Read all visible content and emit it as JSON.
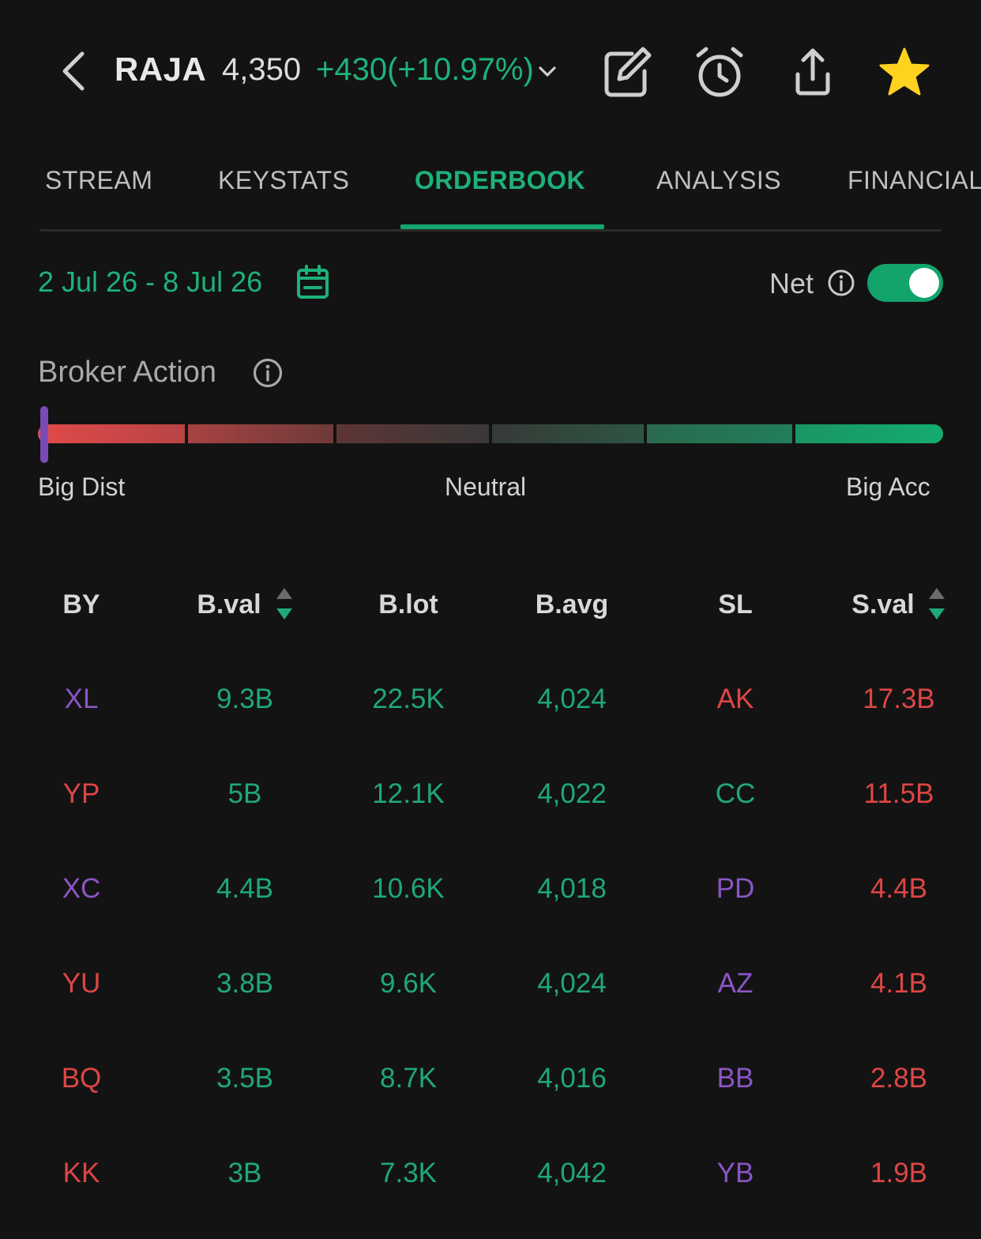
{
  "header": {
    "ticker": "RAJA",
    "price": "4,350",
    "change": "+430(+10.97%)"
  },
  "icons": {
    "back": "chevron-left-icon",
    "change_caret": "chevron-down-icon",
    "edit": "edit-icon",
    "alarm": "alarm-clock-icon",
    "share": "share-icon",
    "favorite": "star-icon",
    "calendar": "calendar-icon",
    "info": "info-icon",
    "sort": "sort-icon"
  },
  "tabs": [
    {
      "label": "STREAM"
    },
    {
      "label": "KEYSTATS"
    },
    {
      "label": "ORDERBOOK"
    },
    {
      "label": "ANALYSIS"
    },
    {
      "label": "FINANCIAL"
    }
  ],
  "active_tab": "ORDERBOOK",
  "filters": {
    "date_range": "2 Jul 26 - 8 Jul 26",
    "net_label": "Net",
    "net_enabled": true
  },
  "broker_action": {
    "title": "Broker Action",
    "labels": {
      "left": "Big Dist",
      "center": "Neutral",
      "right": "Big Acc"
    },
    "position": 0.0,
    "segment_colors": [
      "#d84848",
      "#8d3e3e",
      "#4a3636",
      "#383c39",
      "#2a6e51",
      "#16a86f"
    ]
  },
  "table": {
    "columns": [
      "BY",
      "B.val",
      "B.lot",
      "B.avg",
      "SL",
      "S.val"
    ],
    "rows": [
      {
        "by": "XL",
        "by_color": "purple",
        "bval": "9.3B",
        "blot": "22.5K",
        "bavg": "4,024",
        "sl": "AK",
        "sl_color": "red",
        "sval": "17.3B"
      },
      {
        "by": "YP",
        "by_color": "red",
        "bval": "5B",
        "blot": "12.1K",
        "bavg": "4,022",
        "sl": "CC",
        "sl_color": "green",
        "sval": "11.5B"
      },
      {
        "by": "XC",
        "by_color": "purple",
        "bval": "4.4B",
        "blot": "10.6K",
        "bavg": "4,018",
        "sl": "PD",
        "sl_color": "purple",
        "sval": "4.4B"
      },
      {
        "by": "YU",
        "by_color": "red",
        "bval": "3.8B",
        "blot": "9.6K",
        "bavg": "4,024",
        "sl": "AZ",
        "sl_color": "purple",
        "sval": "4.1B"
      },
      {
        "by": "BQ",
        "by_color": "red",
        "bval": "3.5B",
        "blot": "8.7K",
        "bavg": "4,016",
        "sl": "BB",
        "sl_color": "purple",
        "sval": "2.8B"
      },
      {
        "by": "KK",
        "by_color": "red",
        "bval": "3B",
        "blot": "7.3K",
        "bavg": "4,042",
        "sl": "YB",
        "sl_color": "purple",
        "sval": "1.9B"
      }
    ]
  },
  "colors": {
    "background": "#131313",
    "accent_green": "#1db27a",
    "sell_red": "#e04545",
    "broker_purple": "#8b55c6"
  }
}
